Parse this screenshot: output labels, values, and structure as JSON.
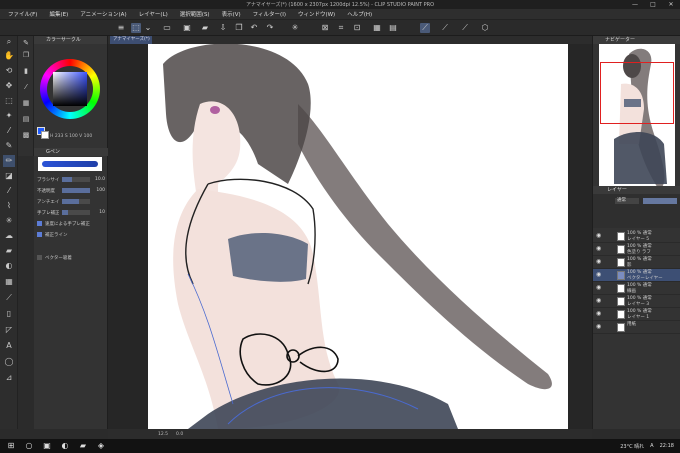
{
  "app": {
    "title": "アナマイヤーズ(*) (1600 x 2307px 1200dpi 12.5%) - CLIP STUDIO PAINT PRO",
    "window_controls": [
      "—",
      "□",
      "✕"
    ]
  },
  "menu": [
    "ファイル(F)",
    "編集(E)",
    "アニメーション(A)",
    "レイヤー(L)",
    "選択範囲(S)",
    "表示(V)",
    "フィルター(I)",
    "ウィンドウ(W)",
    "ヘルプ(H)"
  ],
  "canvas": {
    "tab_label": "アナマイヤーズ(*)",
    "status_zoom": "12.5",
    "status_angle": "0.0"
  },
  "left_panel": {
    "color_header": "カラーサークル",
    "hsv": [
      "H 233",
      "S 100",
      "V 100"
    ],
    "brush_header": "Gペン",
    "properties": [
      {
        "label": "ブラシサイズ",
        "value": "10.0",
        "fill": 0.35
      },
      {
        "label": "不透明度",
        "value": "100",
        "fill": 1.0
      },
      {
        "label": "アンチエイリアス",
        "value": "",
        "fill": 0.6
      },
      {
        "label": "手ブレ補正",
        "value": "10",
        "fill": 0.2
      },
      {
        "label": "速度による手ブレ補正",
        "value": "",
        "fill": 0
      },
      {
        "label": "補正ライン",
        "value": "",
        "fill": 0
      },
      {
        "label": "ベクター吸着",
        "value": "",
        "fill": 0
      }
    ],
    "colors": {
      "main": "#1f5bff",
      "sub": "#ffffff"
    }
  },
  "right_panel": {
    "navigator_header": "ナビゲーター",
    "layer_header": "レイヤー",
    "blend_mode": "通常",
    "opacity": "100",
    "layers": [
      {
        "name": "100 % 通常\nレイヤー 5",
        "selected": false
      },
      {
        "name": "100 % 通常\n色塗り ラフ",
        "selected": false
      },
      {
        "name": "100 % 通常\n影",
        "selected": false
      },
      {
        "name": "100 % 通常\nベクターレイヤー",
        "selected": true
      },
      {
        "name": "100 % 通常\n線画",
        "selected": false
      },
      {
        "name": "100 % 通常\nレイヤー 3",
        "selected": false
      },
      {
        "name": "100 % 通常\nレイヤー 1",
        "selected": false
      },
      {
        "name": "用紙",
        "selected": false
      }
    ]
  },
  "taskbar": {
    "weather": "23°C 晴れ",
    "time": "22:18",
    "lang": "A"
  }
}
